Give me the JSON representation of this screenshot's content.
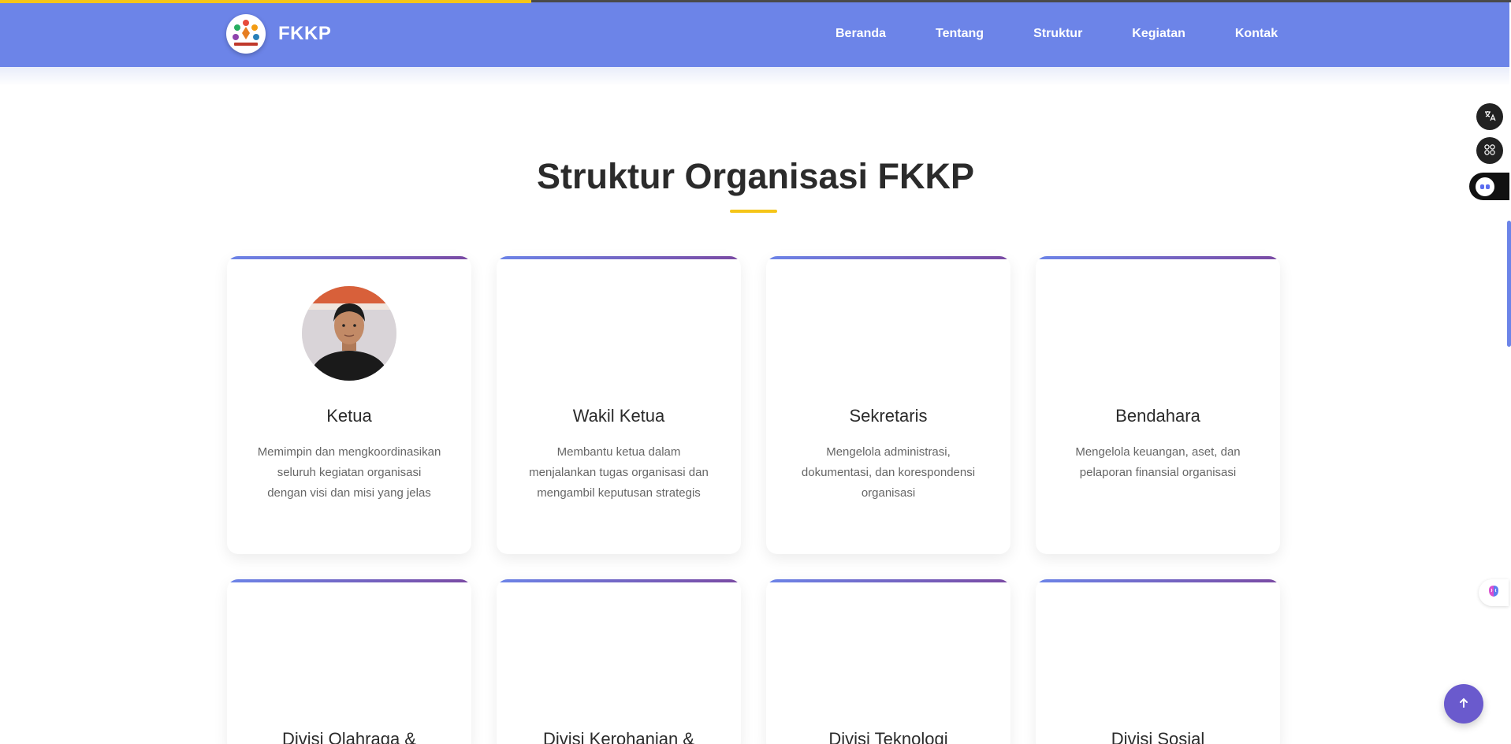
{
  "brand": {
    "name": "FKKP"
  },
  "nav": {
    "items": [
      "Beranda",
      "Tentang",
      "Struktur",
      "Kegiatan",
      "Kontak"
    ]
  },
  "section": {
    "title": "Struktur Organisasi FKKP"
  },
  "cards": [
    {
      "title": "Ketua",
      "description": "Memimpin dan mengkoordinasikan seluruh kegiatan organisasi dengan visi dan misi yang jelas",
      "has_photo": true
    },
    {
      "title": "Wakil Ketua",
      "description": "Membantu ketua dalam menjalankan tugas organisasi dan mengambil keputusan strategis",
      "has_photo": false
    },
    {
      "title": "Sekretaris",
      "description": "Mengelola administrasi, dokumentasi, dan korespondensi organisasi",
      "has_photo": false
    },
    {
      "title": "Bendahara",
      "description": "Mengelola keuangan, aset, dan pelaporan finansial organisasi",
      "has_photo": false
    },
    {
      "title": "Divisi Olahraga &",
      "description": "",
      "has_photo": false
    },
    {
      "title": "Divisi Kerohanian &",
      "description": "",
      "has_photo": false
    },
    {
      "title": "Divisi Teknologi",
      "description": "",
      "has_photo": false
    },
    {
      "title": "Divisi Sosial",
      "description": "",
      "has_photo": false
    }
  ],
  "widgets": {
    "translate_icon": "translate-icon",
    "apps_icon": "grid-icon",
    "assistant_icon": "robot-icon",
    "brain_icon": "brain-icon",
    "back_to_top_icon": "arrow-up-icon"
  },
  "colors": {
    "navbar": "#6c84e8",
    "accent": "#f5c518",
    "back_to_top": "#6a5acd"
  }
}
